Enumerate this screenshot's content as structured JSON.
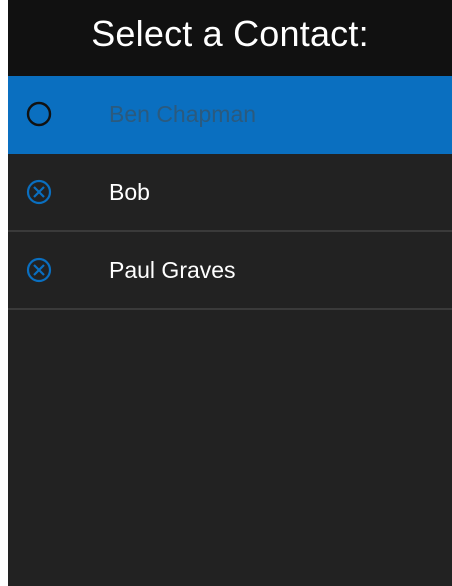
{
  "header": {
    "title": "Select a Contact:"
  },
  "colors": {
    "accent": "#0a6fc0",
    "background": "#222222",
    "header_background": "#111111",
    "selected_label": "#2b5a7e",
    "divider": "#3a3a3a"
  },
  "contacts": [
    {
      "name": "Ben Chapman",
      "selected": true,
      "icon": "radio-unchecked-icon"
    },
    {
      "name": "Bob",
      "selected": false,
      "icon": "circle-x-icon"
    },
    {
      "name": "Paul Graves",
      "selected": false,
      "icon": "circle-x-icon"
    }
  ]
}
